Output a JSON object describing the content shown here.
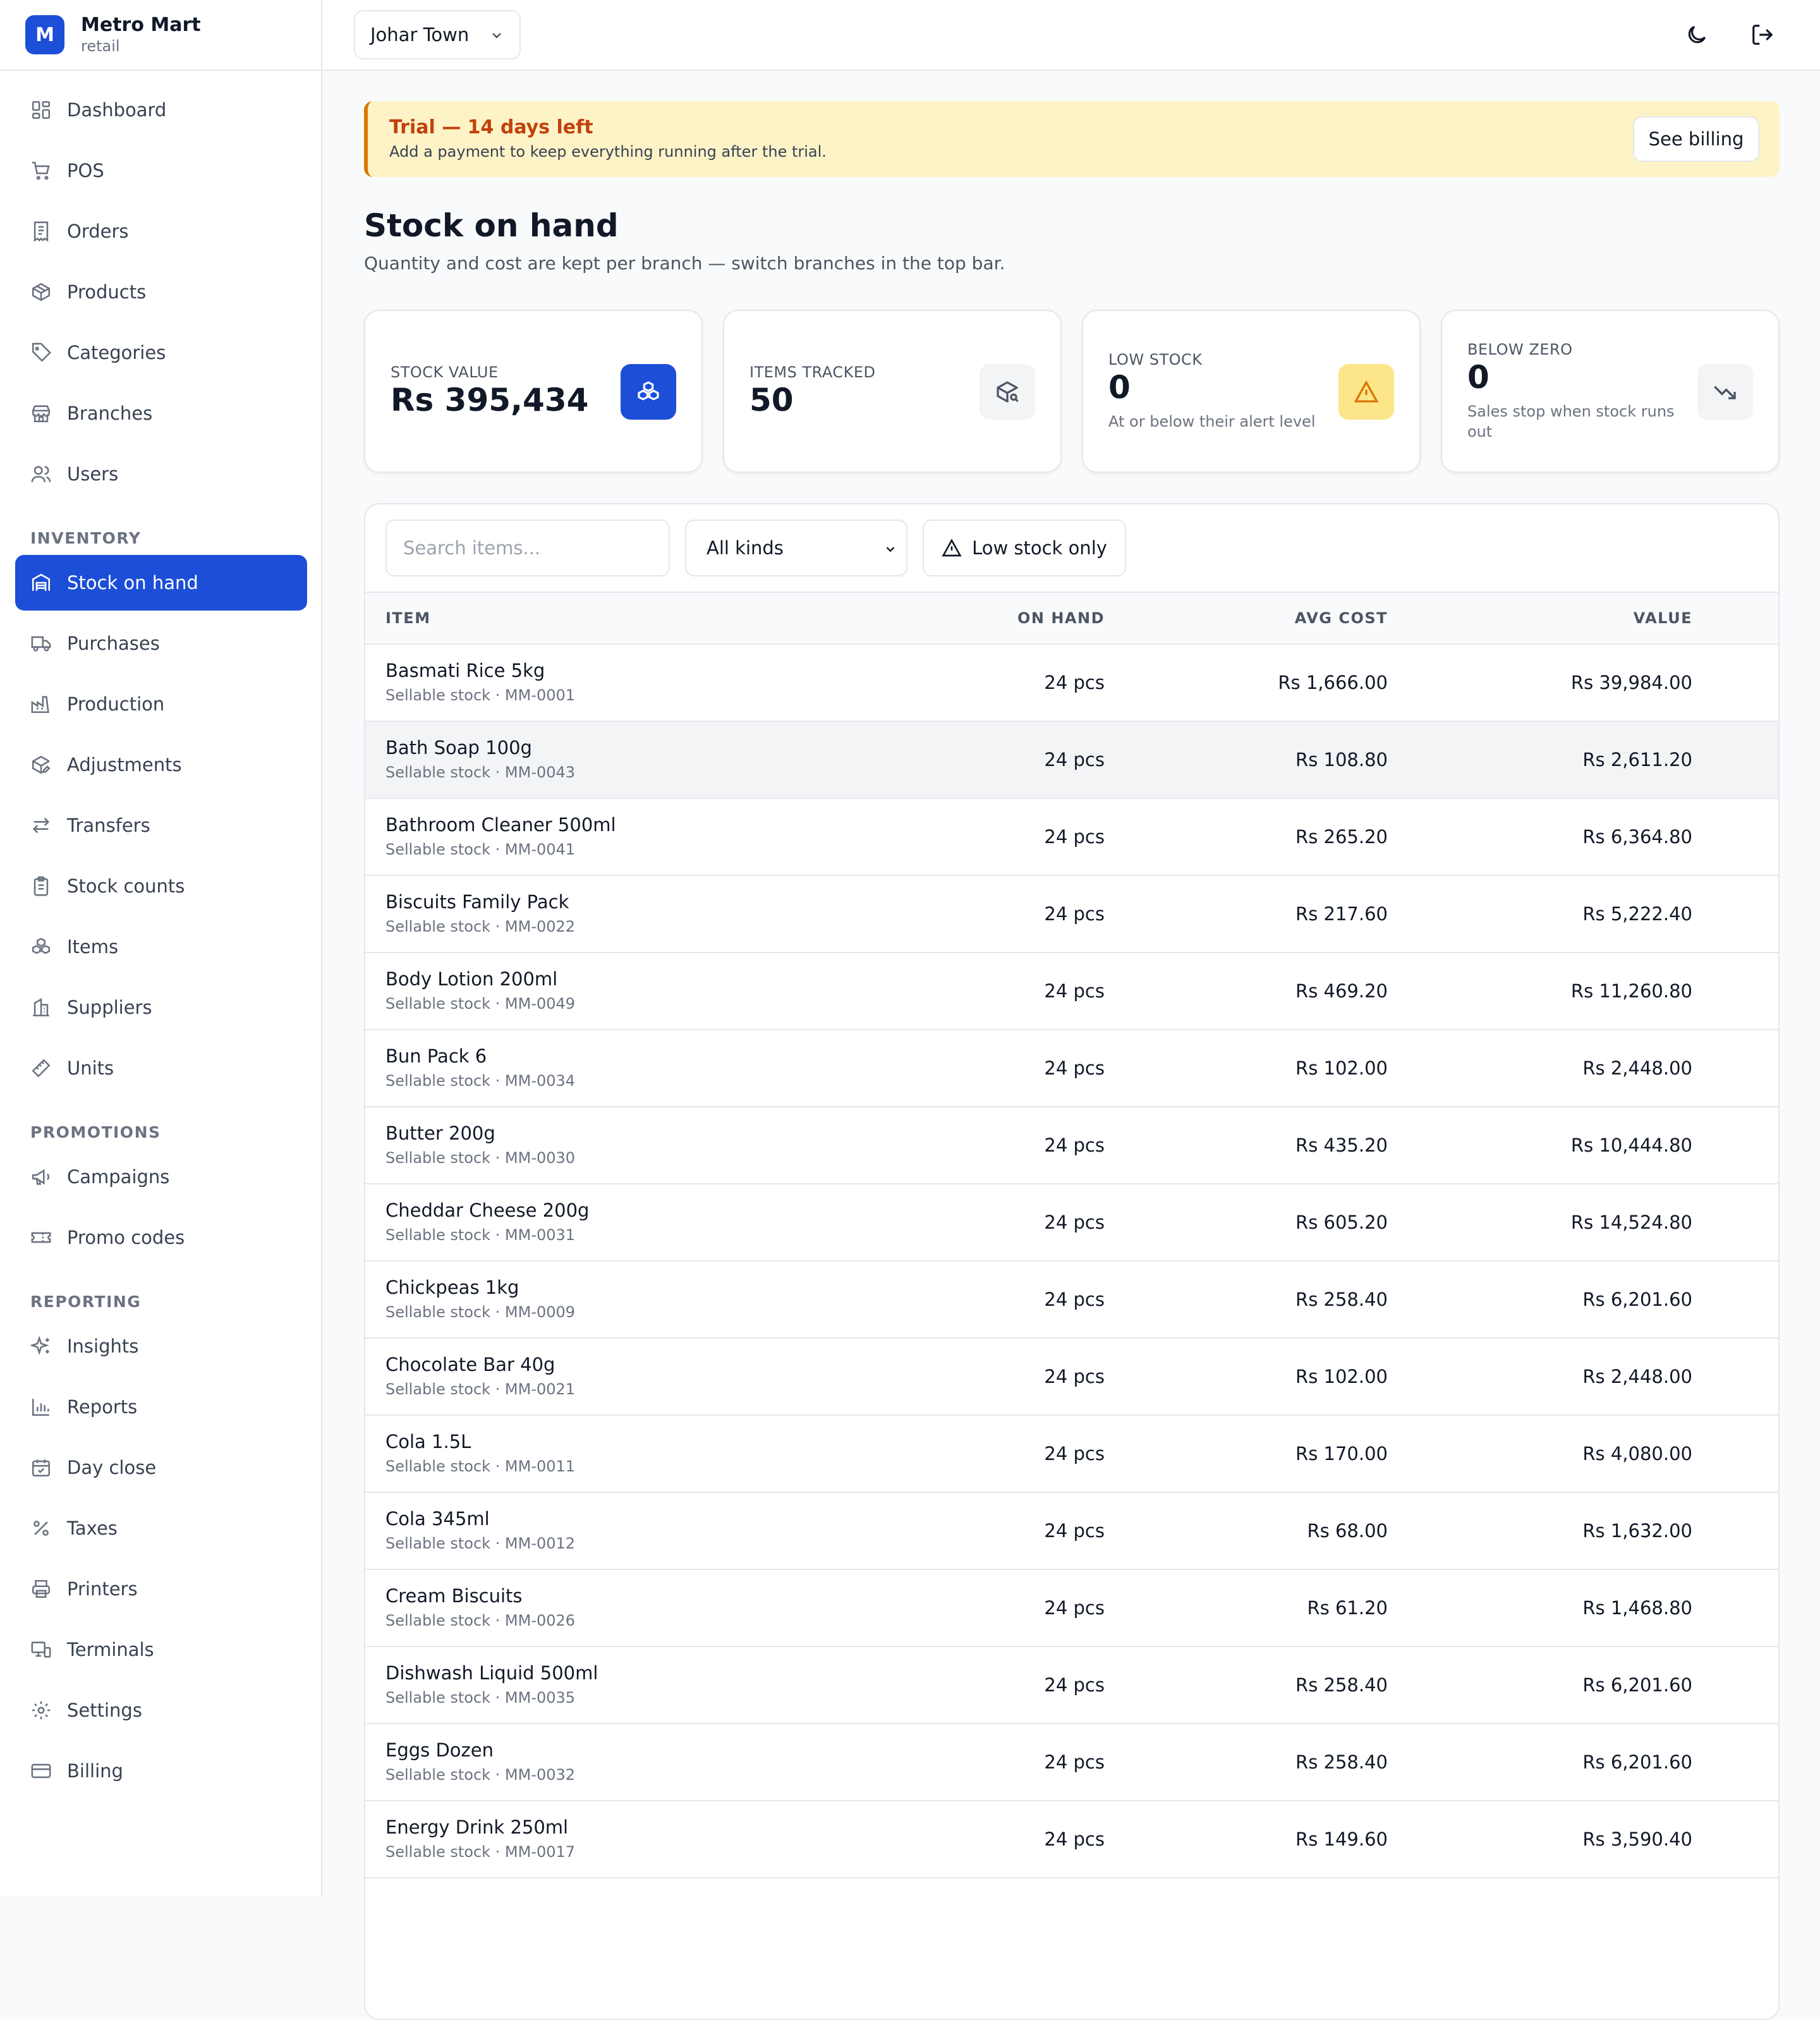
{
  "brand": {
    "initial": "M",
    "name": "Metro Mart",
    "subtitle": "retail"
  },
  "topbar": {
    "branch": "Johar Town",
    "icons": [
      "moon-icon",
      "logout-icon"
    ]
  },
  "nav": {
    "main": [
      {
        "label": "Dashboard",
        "icon": "dashboard-icon"
      },
      {
        "label": "POS",
        "icon": "cart-icon"
      },
      {
        "label": "Orders",
        "icon": "receipt-icon"
      },
      {
        "label": "Products",
        "icon": "package-icon"
      },
      {
        "label": "Categories",
        "icon": "tag-icon"
      },
      {
        "label": "Branches",
        "icon": "store-icon"
      },
      {
        "label": "Users",
        "icon": "users-icon"
      }
    ],
    "inventory_heading": "INVENTORY",
    "inventory": [
      {
        "label": "Stock on hand",
        "icon": "warehouse-icon",
        "active": true
      },
      {
        "label": "Purchases",
        "icon": "truck-icon"
      },
      {
        "label": "Production",
        "icon": "factory-icon"
      },
      {
        "label": "Adjustments",
        "icon": "package-edit-icon"
      },
      {
        "label": "Transfers",
        "icon": "transfer-icon"
      },
      {
        "label": "Stock counts",
        "icon": "clipboard-icon"
      },
      {
        "label": "Items",
        "icon": "boxes-icon"
      },
      {
        "label": "Suppliers",
        "icon": "building-icon"
      },
      {
        "label": "Units",
        "icon": "ruler-icon"
      }
    ],
    "promotions_heading": "PROMOTIONS",
    "promotions": [
      {
        "label": "Campaigns",
        "icon": "megaphone-icon"
      },
      {
        "label": "Promo codes",
        "icon": "ticket-icon"
      }
    ],
    "reporting_heading": "REPORTING",
    "reporting": [
      {
        "label": "Insights",
        "icon": "sparkles-icon"
      },
      {
        "label": "Reports",
        "icon": "bar-chart-icon"
      },
      {
        "label": "Day close",
        "icon": "calendar-check-icon"
      },
      {
        "label": "Taxes",
        "icon": "percent-icon"
      },
      {
        "label": "Printers",
        "icon": "printer-icon"
      },
      {
        "label": "Terminals",
        "icon": "terminal-icon"
      },
      {
        "label": "Settings",
        "icon": "gear-icon"
      },
      {
        "label": "Billing",
        "icon": "credit-card-icon"
      }
    ]
  },
  "trial": {
    "title": "Trial — 14 days left",
    "message": "Add a payment to keep everything running after the trial.",
    "button": "See billing"
  },
  "page": {
    "title": "Stock on hand",
    "subtitle": "Quantity and cost are kept per branch — switch branches in the top bar."
  },
  "cards": {
    "stock_value": {
      "label": "STOCK VALUE",
      "value": "Rs 395,434",
      "icon": "boxes-icon"
    },
    "items_tracked": {
      "label": "ITEMS TRACKED",
      "value": "50",
      "icon": "package-search-icon"
    },
    "low_stock": {
      "label": "LOW STOCK",
      "value": "0",
      "note": "At or below their alert level",
      "icon": "warning-icon"
    },
    "below_zero": {
      "label": "BELOW ZERO",
      "value": "0",
      "note": "Sales stop when stock runs out",
      "icon": "trending-down-icon"
    }
  },
  "filters": {
    "search_placeholder": "Search items...",
    "kind_selected": "All kinds",
    "low_stock_button": "Low stock only"
  },
  "table": {
    "columns": {
      "item": "ITEM",
      "on_hand": "ON HAND",
      "avg_cost": "AVG COST",
      "value": "VALUE"
    },
    "rows": [
      {
        "name": "Basmati Rice 5kg",
        "meta": "Sellable stock · MM-0001",
        "on_hand": "24 pcs",
        "avg_cost": "Rs 1,666.00",
        "value": "Rs 39,984.00"
      },
      {
        "name": "Bath Soap 100g",
        "meta": "Sellable stock · MM-0043",
        "on_hand": "24 pcs",
        "avg_cost": "Rs 108.80",
        "value": "Rs 2,611.20"
      },
      {
        "name": "Bathroom Cleaner 500ml",
        "meta": "Sellable stock · MM-0041",
        "on_hand": "24 pcs",
        "avg_cost": "Rs 265.20",
        "value": "Rs 6,364.80"
      },
      {
        "name": "Biscuits Family Pack",
        "meta": "Sellable stock · MM-0022",
        "on_hand": "24 pcs",
        "avg_cost": "Rs 217.60",
        "value": "Rs 5,222.40"
      },
      {
        "name": "Body Lotion 200ml",
        "meta": "Sellable stock · MM-0049",
        "on_hand": "24 pcs",
        "avg_cost": "Rs 469.20",
        "value": "Rs 11,260.80"
      },
      {
        "name": "Bun Pack 6",
        "meta": "Sellable stock · MM-0034",
        "on_hand": "24 pcs",
        "avg_cost": "Rs 102.00",
        "value": "Rs 2,448.00"
      },
      {
        "name": "Butter 200g",
        "meta": "Sellable stock · MM-0030",
        "on_hand": "24 pcs",
        "avg_cost": "Rs 435.20",
        "value": "Rs 10,444.80"
      },
      {
        "name": "Cheddar Cheese 200g",
        "meta": "Sellable stock · MM-0031",
        "on_hand": "24 pcs",
        "avg_cost": "Rs 605.20",
        "value": "Rs 14,524.80"
      },
      {
        "name": "Chickpeas 1kg",
        "meta": "Sellable stock · MM-0009",
        "on_hand": "24 pcs",
        "avg_cost": "Rs 258.40",
        "value": "Rs 6,201.60"
      },
      {
        "name": "Chocolate Bar 40g",
        "meta": "Sellable stock · MM-0021",
        "on_hand": "24 pcs",
        "avg_cost": "Rs 102.00",
        "value": "Rs 2,448.00"
      },
      {
        "name": "Cola 1.5L",
        "meta": "Sellable stock · MM-0011",
        "on_hand": "24 pcs",
        "avg_cost": "Rs 170.00",
        "value": "Rs 4,080.00"
      },
      {
        "name": "Cola 345ml",
        "meta": "Sellable stock · MM-0012",
        "on_hand": "24 pcs",
        "avg_cost": "Rs 68.00",
        "value": "Rs 1,632.00"
      },
      {
        "name": "Cream Biscuits",
        "meta": "Sellable stock · MM-0026",
        "on_hand": "24 pcs",
        "avg_cost": "Rs 61.20",
        "value": "Rs 1,468.80"
      },
      {
        "name": "Dishwash Liquid 500ml",
        "meta": "Sellable stock · MM-0035",
        "on_hand": "24 pcs",
        "avg_cost": "Rs 258.40",
        "value": "Rs 6,201.60"
      },
      {
        "name": "Eggs Dozen",
        "meta": "Sellable stock · MM-0032",
        "on_hand": "24 pcs",
        "avg_cost": "Rs 258.40",
        "value": "Rs 6,201.60"
      },
      {
        "name": "Energy Drink 250ml",
        "meta": "Sellable stock · MM-0017",
        "on_hand": "24 pcs",
        "avg_cost": "Rs 149.60",
        "value": "Rs 3,590.40"
      }
    ]
  },
  "colors": {
    "primary": "#1d4ed8",
    "trial_bg": "#fef3c7",
    "trial_accent": "#d97706",
    "trial_title": "#c2410c",
    "warning_bg": "#fde68a"
  }
}
